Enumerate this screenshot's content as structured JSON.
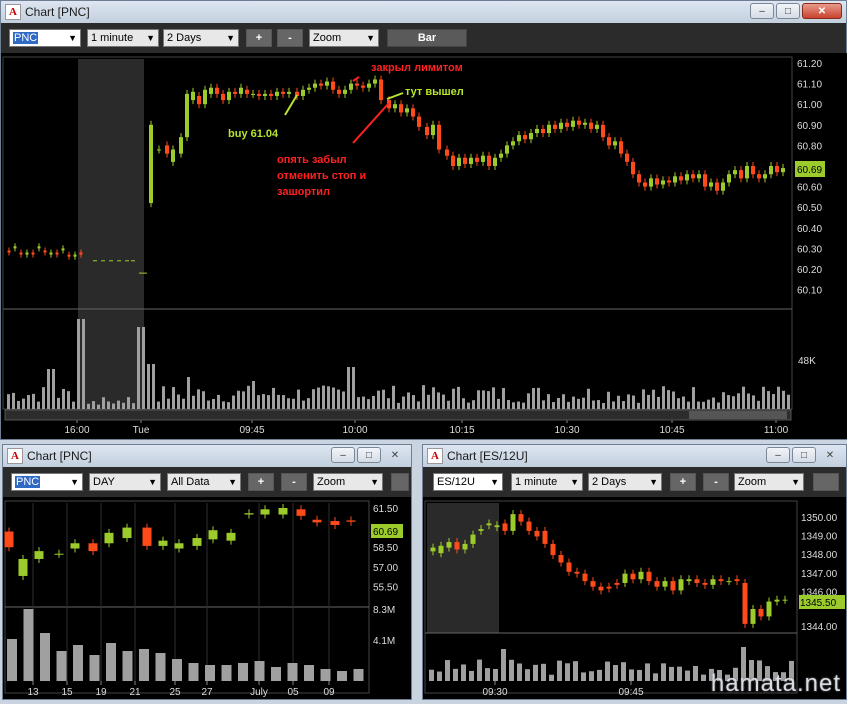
{
  "main": {
    "title": "Chart [PNC]",
    "symbol": "PNC",
    "interval": "1 minute",
    "range": "2 Days",
    "plus": "+",
    "minus": "-",
    "zoom": "Zoom",
    "style": "Bar",
    "price_labels": [
      "61.20",
      "61.10",
      "61.00",
      "60.90",
      "60.80",
      "60.70",
      "60.60",
      "60.50",
      "60.40",
      "60.30",
      "60.20",
      "60.10"
    ],
    "last_price": "60.69",
    "volume_label": "48K",
    "time_labels": [
      "16:00",
      "Tue",
      "09:45",
      "10:00",
      "10:15",
      "10:30",
      "10:45",
      "11:00"
    ],
    "annotations": {
      "closed_limit": "закрыл лимитом",
      "exited_here": "тут вышел",
      "buy": "buy 61.04",
      "forgot_line1": "опять забыл",
      "forgot_line2": "отменить стоп и",
      "forgot_line3": "зашортил"
    }
  },
  "daily": {
    "title": "Chart [PNC]",
    "symbol": "PNC",
    "interval": "DAY",
    "range": "All Data",
    "plus": "+",
    "minus": "-",
    "zoom": "Zoom",
    "price_labels": [
      "61.50",
      "60.00",
      "58.50",
      "57.00",
      "55.50"
    ],
    "last_price": "60.69",
    "vol_labels": [
      "8.3M",
      "4.1M"
    ],
    "date_labels": [
      "13",
      "15",
      "19",
      "21",
      "25",
      "27",
      "July",
      "05",
      "09"
    ]
  },
  "es": {
    "title": "Chart [ES/12U]",
    "symbol": "ES/12U",
    "interval": "1 minute",
    "range": "2 Days",
    "plus": "+",
    "minus": "-",
    "zoom": "Zoom",
    "price_labels": [
      "1350.00",
      "1349.00",
      "1348.00",
      "1347.00",
      "1346.00",
      "1344.00"
    ],
    "last_price": "1345.50",
    "time_labels": [
      "09:30",
      "09:45"
    ]
  },
  "watermark": "hamata.net",
  "colors": {
    "up": "#9ccc2c",
    "down": "#ff4a1a",
    "last_badge": "#9ccc2c",
    "annotation_red": "#ff2020",
    "annotation_green": "#b8e62c"
  }
}
